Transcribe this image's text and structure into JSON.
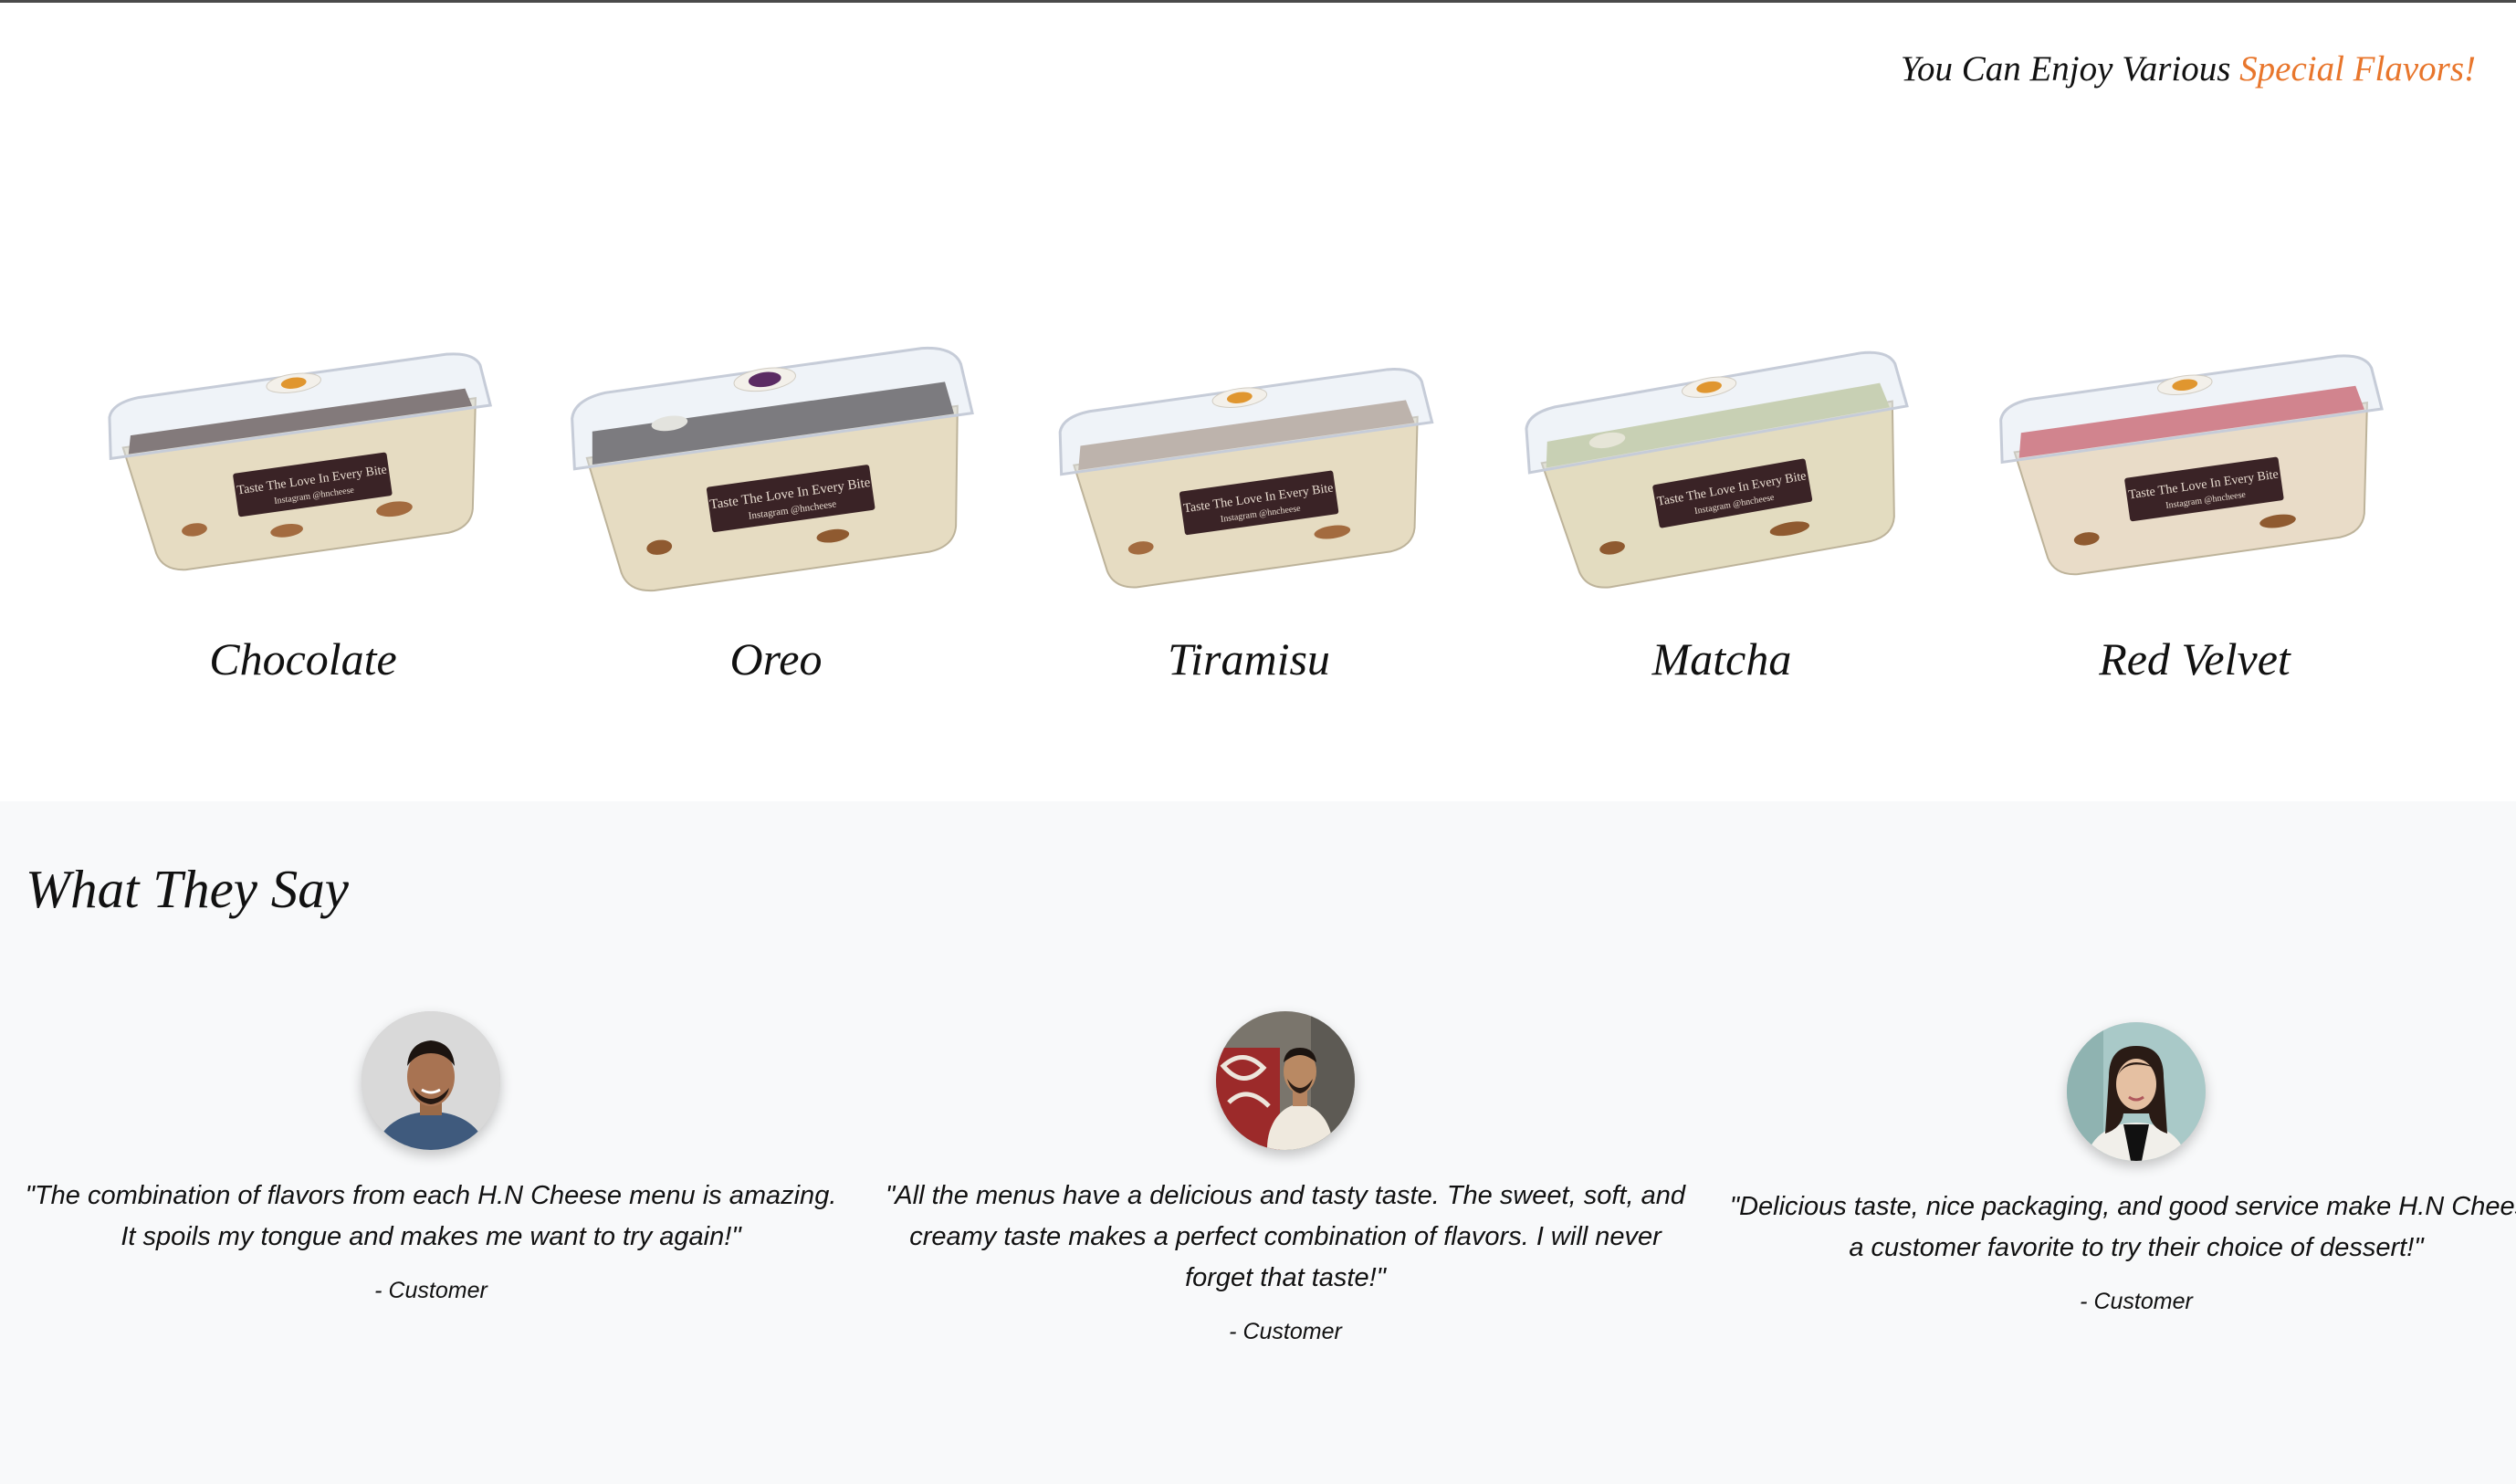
{
  "tagline": {
    "text": "You Can Enjoy Various ",
    "accent": "Special Flavors!"
  },
  "colors": {
    "accent": "#e8762c",
    "section_bg": "#f8f9fa"
  },
  "flavors": [
    {
      "name": "Chocolate",
      "topping": "#3b241c",
      "label": "Taste The Love In Every Bite"
    },
    {
      "name": "Oreo",
      "topping": "#2f2624",
      "label": "Taste The Love In Every Bite"
    },
    {
      "name": "Tiramisu",
      "topping": "#a58a76",
      "label": "Taste The Love In Every Bite"
    },
    {
      "name": "Matcha",
      "topping": "#b8bf84",
      "label": "Taste The Love In Every Bite"
    },
    {
      "name": "Red Velvet",
      "topping": "#c9353e",
      "label": "Taste The Love In Every Bite"
    }
  ],
  "testimonials_section": {
    "title": "What They Say",
    "items": [
      {
        "quote": "\"The combination of flavors from each H.N Cheese menu is amazing. It spoils my tongue and makes me want to try again!\"",
        "author": "- Customer",
        "avatar_icon": "customer-photo-1"
      },
      {
        "quote": "\"All the menus have a delicious and tasty taste. The sweet, soft, and creamy taste makes a perfect combination of flavors. I will never forget that taste!\"",
        "author": "- Customer",
        "avatar_icon": "customer-photo-2"
      },
      {
        "quote": "\"Delicious taste, nice packaging, and good service make H.N Cheese a customer favorite to try their choice of dessert!\"",
        "author": "- Customer",
        "avatar_icon": "customer-photo-3"
      }
    ]
  }
}
